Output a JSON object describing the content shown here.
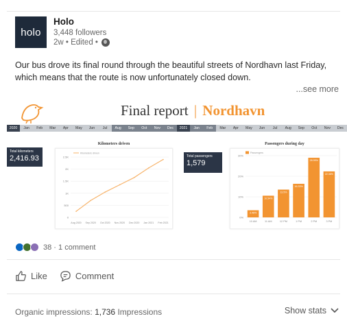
{
  "post": {
    "company": "Holo",
    "logo_text": "holo",
    "followers": "3,448 followers",
    "time_edited": "2w • Edited •",
    "text": "Our bus drove its final round through the beautiful streets of Nordhavn last Friday, which means that the route is now unfortunately closed down.",
    "see_more": "...see more"
  },
  "report": {
    "title": "Final report",
    "separator": "|",
    "place": "Nordhavn",
    "timeline": [
      "2020",
      "Jan",
      "Feb",
      "Mar",
      "Apr",
      "May",
      "Jun",
      "Jul",
      "Aug",
      "Sep",
      "Oct",
      "Nov",
      "Dec",
      "2021",
      "Jan",
      "Feb",
      "Mar",
      "Apr",
      "May",
      "Jun",
      "Jul",
      "Aug",
      "Sep",
      "Oct",
      "Nov",
      "Dec"
    ],
    "kpi_km_label": "Total kilometers",
    "kpi_km_value": "2,416.93",
    "kpi_pass_label": "Total passengers",
    "kpi_pass_value": "1,579"
  },
  "chart_data": [
    {
      "type": "line",
      "title": "Kilometers driven",
      "legend": "Kilometers driven",
      "x": [
        "Aug 2020",
        "Sep 2020",
        "Oct 2020",
        "Nov 2020",
        "Dec 2020",
        "Jan 2021",
        "Feb 2021"
      ],
      "values": [
        250,
        700,
        1050,
        1350,
        1650,
        2050,
        2400
      ],
      "yticks": [
        "0",
        "500",
        "1K",
        "1.5K",
        "2K",
        "2.5K"
      ],
      "ylim": [
        0,
        2500
      ],
      "grid": true
    },
    {
      "type": "bar",
      "title": "Passengers during day",
      "legend": "Passengers",
      "categories": [
        "10 AM",
        "11 AM",
        "12 PM",
        "1 PM",
        "2 PM",
        "3 PM"
      ],
      "values": [
        3.48,
        10.54,
        13.5,
        16.33,
        28.99,
        22.36
      ],
      "data_labels": [
        "3.48%",
        "10.54%",
        "13.5%",
        "16.33%",
        "28.99%",
        "22.36%"
      ],
      "yticks": [
        "0%",
        "10%",
        "20%",
        "30%"
      ],
      "ylim": [
        0,
        30
      ],
      "grid": true,
      "color": "#f29431"
    }
  ],
  "social": {
    "reaction_count": "38",
    "comments": "1 comment",
    "like_label": "Like",
    "comment_label": "Comment"
  },
  "footer": {
    "impressions_label": "Organic impressions:",
    "impressions_value": "1,736",
    "impressions_unit": "Impressions",
    "show_stats": "Show stats"
  },
  "colors": {
    "accent": "#f29431",
    "navy": "#2b3546",
    "linkedin_blue": "#0a66c2"
  }
}
